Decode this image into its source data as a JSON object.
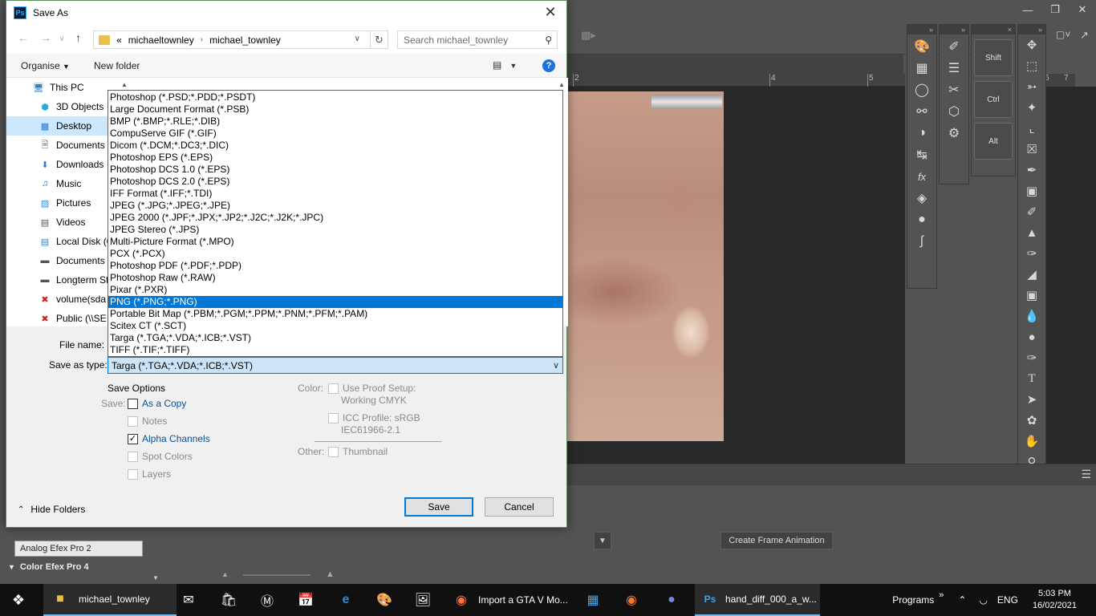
{
  "dialog": {
    "title": "Save As",
    "address": {
      "parts": [
        "michaeltownley",
        "michael_townley"
      ]
    },
    "search_placeholder": "Search michael_townley",
    "organise_label": "Organise",
    "new_folder_label": "New folder",
    "nav_items": [
      {
        "label": "This PC",
        "icon": "computer-icon"
      },
      {
        "label": "3D Objects",
        "icon": "cube-icon"
      },
      {
        "label": "Desktop",
        "icon": "desktop-icon"
      },
      {
        "label": "Documents",
        "icon": "document-icon"
      },
      {
        "label": "Downloads",
        "icon": "download-icon"
      },
      {
        "label": "Music",
        "icon": "music-icon"
      },
      {
        "label": "Pictures",
        "icon": "pictures-icon"
      },
      {
        "label": "Videos",
        "icon": "video-icon"
      },
      {
        "label": "Local Disk (C",
        "icon": "disk-icon"
      },
      {
        "label": "Documents",
        "icon": "drive-icon"
      },
      {
        "label": "Longterm St",
        "icon": "drive-icon"
      },
      {
        "label": "volume(sda",
        "icon": "network-drive-icon"
      },
      {
        "label": "Public (\\\\SE",
        "icon": "network-drive-icon"
      }
    ],
    "file_name_label": "File name:",
    "save_as_type_label": "Save as type:",
    "save_as_type_value": "Targa (*.TGA;*.VDA;*.ICB;*.VST)",
    "type_options": [
      "Photoshop (*.PSD;*.PDD;*.PSDT)",
      "Large Document Format (*.PSB)",
      "BMP (*.BMP;*.RLE;*.DIB)",
      "CompuServe GIF (*.GIF)",
      "Dicom (*.DCM;*.DC3;*.DIC)",
      "Photoshop EPS (*.EPS)",
      "Photoshop DCS 1.0 (*.EPS)",
      "Photoshop DCS 2.0 (*.EPS)",
      "IFF Format (*.IFF;*.TDI)",
      "JPEG (*.JPG;*.JPEG;*.JPE)",
      "JPEG 2000 (*.JPF;*.JPX;*.JP2;*.J2C;*.J2K;*.JPC)",
      "JPEG Stereo (*.JPS)",
      "Multi-Picture Format (*.MPO)",
      "PCX (*.PCX)",
      "Photoshop PDF (*.PDF;*.PDP)",
      "Photoshop Raw (*.RAW)",
      "Pixar (*.PXR)",
      "PNG (*.PNG;*.PNG)",
      "Portable Bit Map (*.PBM;*.PGM;*.PPM;*.PNM;*.PFM;*.PAM)",
      "Scitex CT (*.SCT)",
      "Targa (*.TGA;*.VDA;*.ICB;*.VST)",
      "TIFF (*.TIF;*.TIFF)"
    ],
    "highlighted_option": "PNG (*.PNG;*.PNG)",
    "save_options": {
      "title": "Save Options",
      "save_label": "Save:",
      "as_a_copy": "As a Copy",
      "notes": "Notes",
      "alpha_channels": "Alpha Channels",
      "spot_colors": "Spot Colors",
      "layers": "Layers",
      "color_label": "Color:",
      "use_proof_setup": "Use Proof Setup:",
      "working_cmyk": "Working CMYK",
      "icc_profile": "ICC Profile:  sRGB",
      "icc_profile_name": "IEC61966-2.1",
      "other_label": "Other:",
      "thumbnail": "Thumbnail"
    },
    "hide_folders_label": "Hide Folders",
    "save_button": "Save",
    "cancel_button": "Cancel"
  },
  "photoshop": {
    "ruler_ticks": [
      "2",
      "4",
      "5",
      "6",
      "7"
    ],
    "modifier_keys": [
      "Shift",
      "Ctrl",
      "Alt"
    ],
    "create_frame_animation": "Create Frame Animation"
  },
  "filter_panel": {
    "analog_efex": "Analog Efex Pro 2",
    "color_efex": "Color Efex Pro 4"
  },
  "taskbar": {
    "folder_window": "michael_townley",
    "firefox_window": "Import a GTA V Mo...",
    "ps_window": "hand_diff_000_a_w...",
    "programs_label": "Programs",
    "language": "ENG",
    "time": "5:03 PM",
    "date": "16/02/2021"
  }
}
